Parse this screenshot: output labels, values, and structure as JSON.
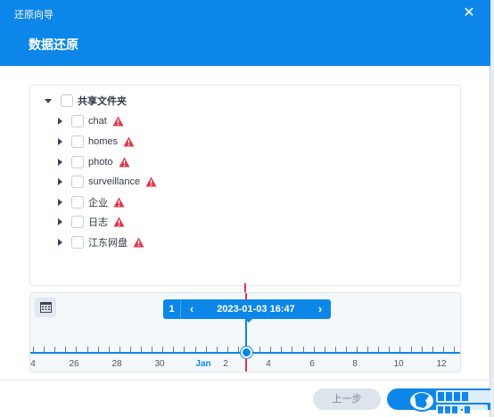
{
  "window": {
    "title": "还原向导",
    "page_title": "数据还原"
  },
  "tree": {
    "root": {
      "label": "共享文件夹"
    },
    "items": [
      {
        "label": "chat",
        "warning": true
      },
      {
        "label": "homes",
        "warning": true
      },
      {
        "label": "photo",
        "warning": true
      },
      {
        "label": "surveillance",
        "warning": true
      },
      {
        "label": "企业",
        "warning": true
      },
      {
        "label": "日志",
        "warning": true
      },
      {
        "label": "江东网盘",
        "warning": true
      }
    ]
  },
  "timeline": {
    "version_count": "1",
    "selected_datetime": "2023-01-03 16:47",
    "tick_labels": [
      "4",
      "26",
      "28",
      "30",
      "Jan",
      "2",
      "4",
      "6",
      "8",
      "10",
      "12"
    ],
    "month_label": "Jan"
  },
  "footer": {
    "prev_label": "上一步"
  },
  "colors": {
    "accent": "#0d86e9",
    "warning": "#e0364a",
    "cursor": "#e0364a"
  },
  "icons": {
    "close": "close-icon",
    "calendar": "calendar-icon",
    "warning": "warning-icon",
    "expand": "chevron-right-icon",
    "collapse": "chevron-down-icon"
  }
}
